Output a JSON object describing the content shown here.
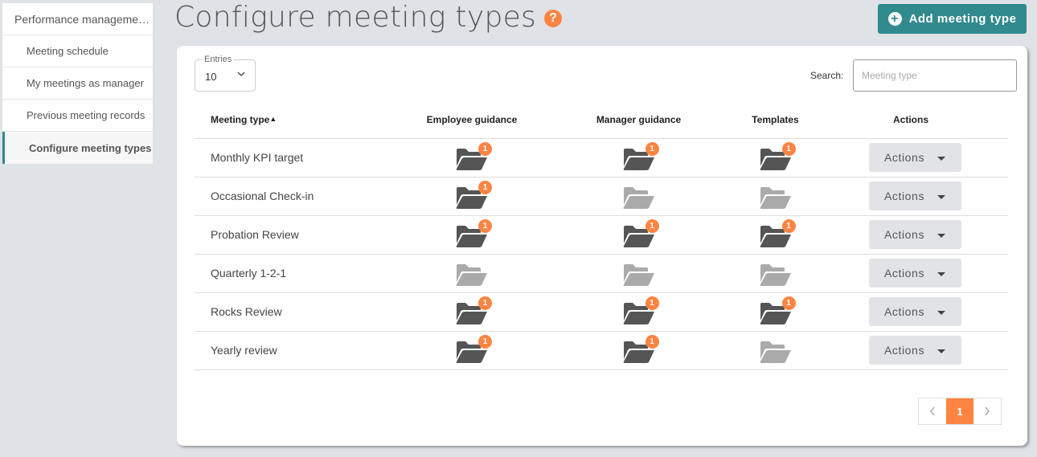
{
  "sidebar": {
    "items": [
      {
        "label": "Performance manageme…",
        "active": false
      },
      {
        "label": "Meeting schedule",
        "active": false
      },
      {
        "label": "My meetings as manager",
        "active": false
      },
      {
        "label": "Previous meeting records",
        "active": false
      },
      {
        "label": "Configure meeting types",
        "active": true
      }
    ]
  },
  "header": {
    "title": "Configure meeting types",
    "help_icon": "?",
    "add_button": {
      "icon": "+",
      "label": "Add meeting type"
    }
  },
  "colors": {
    "accent": "#318a8d",
    "badge": "#fe8442",
    "folder_active": "#555555",
    "folder_empty": "#aaaaaa"
  },
  "entries": {
    "label": "Entries",
    "value": "10"
  },
  "search": {
    "label": "Search:",
    "placeholder": "Meeting type",
    "value": ""
  },
  "table": {
    "columns": [
      "Meeting type",
      "Employee guidance",
      "Manager guidance",
      "Templates",
      "Actions"
    ],
    "sort_indicator": "▲",
    "rows": [
      {
        "name": "Monthly KPI target",
        "employee": "1",
        "manager": "1",
        "templates": "1",
        "action": "Actions"
      },
      {
        "name": "Occasional Check-in",
        "employee": "1",
        "manager": "",
        "templates": "",
        "action": "Actions"
      },
      {
        "name": "Probation Review",
        "employee": "1",
        "manager": "1",
        "templates": "1",
        "action": "Actions"
      },
      {
        "name": "Quarterly 1-2-1",
        "employee": "",
        "manager": "",
        "templates": "",
        "action": "Actions"
      },
      {
        "name": "Rocks Review",
        "employee": "1",
        "manager": "1",
        "templates": "1",
        "action": "Actions"
      },
      {
        "name": "Yearly review",
        "employee": "1",
        "manager": "1",
        "templates": "",
        "action": "Actions"
      }
    ]
  },
  "pagination": {
    "prev": "‹",
    "current": "1",
    "next": "›"
  }
}
